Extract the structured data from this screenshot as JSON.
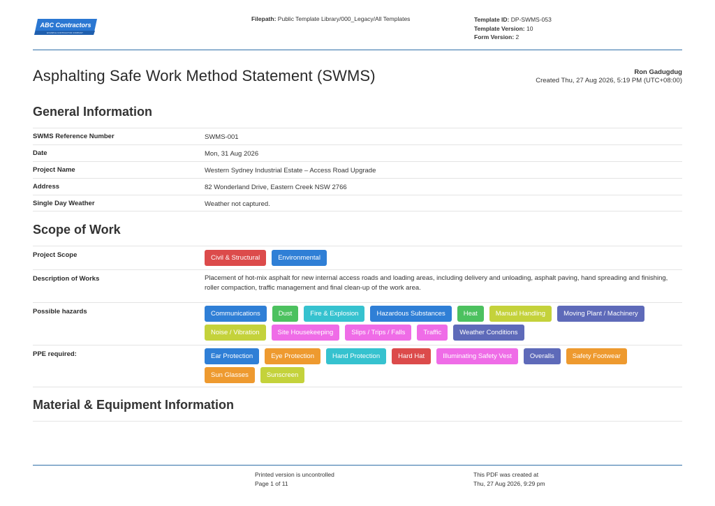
{
  "header": {
    "logo": {
      "name": "ABC Contractors",
      "tagline": "EXAMPLE CONTRACTOR COMPANY",
      "icon": "company-logo"
    },
    "filepath_label": "Filepath:",
    "filepath_value": "Public Template Library/000_Legacy/All Templates",
    "template_id_label": "Template ID:",
    "template_id_value": "DP-SWMS-053",
    "template_version_label": "Template Version:",
    "template_version_value": "10",
    "form_version_label": "Form Version:",
    "form_version_value": "2"
  },
  "document": {
    "title": "Asphalting Safe Work Method Statement (SWMS)",
    "author": "Ron Gadugdug",
    "created": "Created Thu, 27 Aug 2026, 5:19 PM (UTC+08:00)"
  },
  "general": {
    "heading": "General Information",
    "rows": [
      {
        "label": "SWMS Reference Number",
        "value": "SWMS-001"
      },
      {
        "label": "Date",
        "value": "Mon, 31 Aug 2026"
      },
      {
        "label": "Project Name",
        "value": "Western Sydney Industrial Estate – Access Road Upgrade"
      },
      {
        "label": "Address",
        "value": "82 Wonderland Drive, Eastern Creek NSW 2766"
      },
      {
        "label": "Single Day Weather",
        "value": "Weather not captured."
      }
    ]
  },
  "scope": {
    "heading": "Scope of Work",
    "project_scope_label": "Project Scope",
    "project_scope_tags": [
      {
        "label": "Civil & Structural",
        "color": "#dc4b4b"
      },
      {
        "label": "Environmental",
        "color": "#2f7fd6"
      }
    ],
    "description_label": "Description of Works",
    "description_value": "Placement of hot-mix asphalt for new internal access roads and loading areas, including delivery and unloading, asphalt paving, hand spreading and finishing, roller compaction, traffic management and final clean-up of the work area.",
    "hazards_label": "Possible hazards",
    "hazards": [
      {
        "label": "Communications",
        "color": "#2f7fd6"
      },
      {
        "label": "Dust",
        "color": "#4cc15f"
      },
      {
        "label": "Fire & Explosion",
        "color": "#36c2cf"
      },
      {
        "label": "Hazardous Substances",
        "color": "#2f7fd6"
      },
      {
        "label": "Heat",
        "color": "#4cc15f"
      },
      {
        "label": "Manual Handling",
        "color": "#c4d23b"
      },
      {
        "label": "Moving Plant / Machinery",
        "color": "#5e6ab9"
      },
      {
        "label": "Noise / Vibration",
        "color": "#c4d23b"
      },
      {
        "label": "Site Housekeeping",
        "color": "#ef6ce7"
      },
      {
        "label": "Slips / Trips / Falls",
        "color": "#ef6ce7"
      },
      {
        "label": "Traffic",
        "color": "#ef6ce7"
      },
      {
        "label": "Weather Conditions",
        "color": "#5e6ab9"
      }
    ],
    "ppe_label": "PPE required:",
    "ppe": [
      {
        "label": "Ear Protection",
        "color": "#2f7fd6"
      },
      {
        "label": "Eye Protection",
        "color": "#ee9a2f"
      },
      {
        "label": "Hand Protection",
        "color": "#36c2cf"
      },
      {
        "label": "Hard Hat",
        "color": "#dc4b4b"
      },
      {
        "label": "Illuminating Safety Vest",
        "color": "#ef6ce7"
      },
      {
        "label": "Overalls",
        "color": "#5e6ab9"
      },
      {
        "label": "Safety Footwear",
        "color": "#ee9a2f"
      },
      {
        "label": "Sun Glasses",
        "color": "#ee9a2f"
      },
      {
        "label": "Sunscreen",
        "color": "#c4d23b"
      }
    ]
  },
  "material": {
    "heading": "Material & Equipment Information"
  },
  "footer": {
    "uncontrolled": "Printed version is uncontrolled",
    "page": "Page 1 of 11",
    "pdf_created_label": "This PDF was created at",
    "pdf_created_value": "Thu, 27 Aug 2026, 9:29 pm"
  }
}
